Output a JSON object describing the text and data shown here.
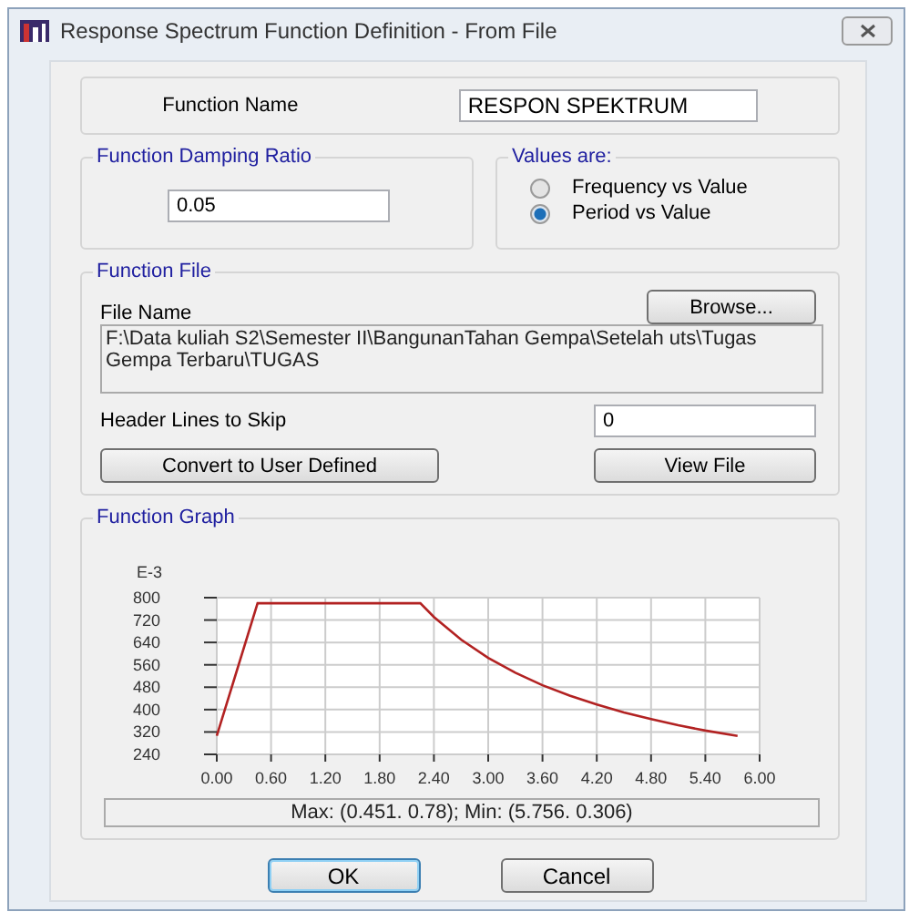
{
  "window": {
    "title": "Response Spectrum Function Definition - From File"
  },
  "function_name": {
    "label": "Function Name",
    "value": "RESPON SPEKTRUM"
  },
  "damping": {
    "title": "Function Damping Ratio",
    "value": "0.05"
  },
  "values_are": {
    "title": "Values are:",
    "options": [
      {
        "label": "Frequency vs Value",
        "selected": false
      },
      {
        "label": "Period vs Value",
        "selected": true
      }
    ]
  },
  "function_file": {
    "title": "Function File",
    "browse_button": "Browse...",
    "file_name_label": "File Name",
    "file_name": "F:\\Data kuliah S2\\Semester II\\BangunanTahan Gempa\\Setelah uts\\Tugas Gempa Terbaru\\TUGAS",
    "header_lines_label": "Header Lines to Skip",
    "header_lines": "0",
    "convert_button": "Convert to User Defined",
    "view_button": "View File"
  },
  "function_graph": {
    "title": "Function Graph",
    "chart_data": {
      "type": "line",
      "ylabel": "E-3",
      "x": [
        0,
        0.451,
        2.25,
        2.4,
        2.7,
        3,
        3.3,
        3.6,
        3.9,
        4.2,
        4.5,
        4.8,
        5.1,
        5.4,
        5.756
      ],
      "grid": true,
      "series": [
        {
          "color": "#b22222",
          "values": [
            306,
            780,
            780,
            731,
            650,
            585,
            532,
            487,
            450,
            418,
            390,
            366,
            344,
            325,
            306
          ]
        }
      ],
      "xlim": [
        0,
        6
      ],
      "ylim": [
        240,
        800
      ],
      "xticks": [
        {
          "value": 0,
          "label": "0.00"
        },
        {
          "value": 0.6,
          "label": "0.60"
        },
        {
          "value": 1.2,
          "label": "1.20"
        },
        {
          "value": 1.8,
          "label": "1.80"
        },
        {
          "value": 2.4,
          "label": "2.40"
        },
        {
          "value": 3,
          "label": "3.00"
        },
        {
          "value": 3.6,
          "label": "3.60"
        },
        {
          "value": 4.2,
          "label": "4.20"
        },
        {
          "value": 4.8,
          "label": "4.80"
        },
        {
          "value": 5.4,
          "label": "5.40"
        },
        {
          "value": 6,
          "label": "6.00"
        }
      ],
      "yticks": [
        240,
        320,
        400,
        480,
        560,
        640,
        720,
        800
      ]
    },
    "summary": "Max: (0.451. 0.78);   Min: (5.756. 0.306)"
  },
  "buttons": [
    "OK",
    "Cancel"
  ]
}
